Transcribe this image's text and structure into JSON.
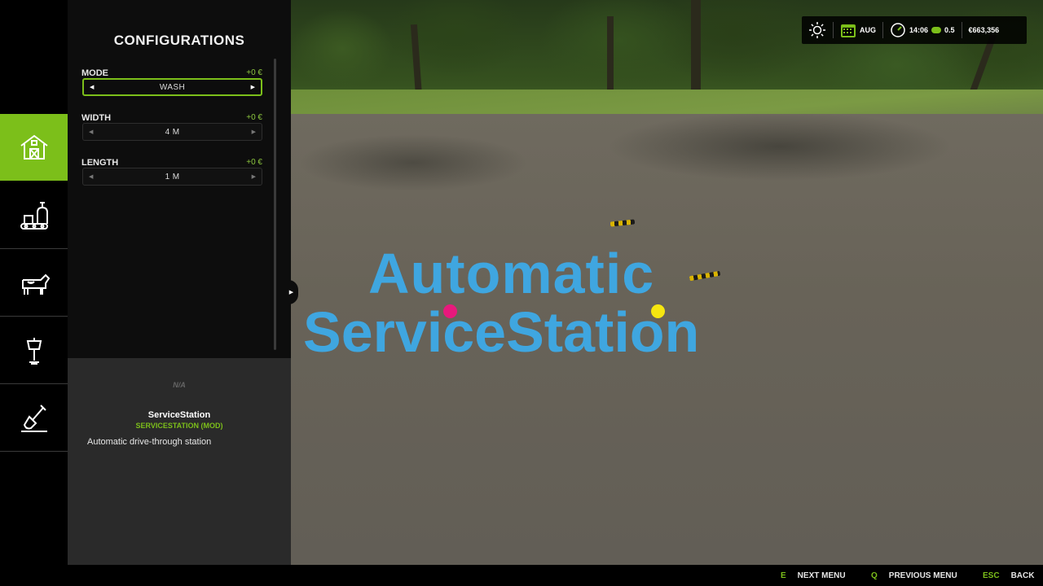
{
  "config_panel": {
    "title": "CONFIGURATIONS",
    "options": [
      {
        "label": "MODE",
        "price": "+0 €",
        "value": "WASH",
        "focused": true
      },
      {
        "label": "WIDTH",
        "price": "+0 €",
        "value": "4 M",
        "focused": false
      },
      {
        "label": "LENGTH",
        "price": "+0 €",
        "value": "1 M",
        "focused": false
      }
    ]
  },
  "info_panel": {
    "na_label": "N/A",
    "item_name": "ServiceStation",
    "mod_name": "SERVICESTATION (MOD)",
    "description": "Automatic drive-through station"
  },
  "categories": [
    {
      "icon": "barn-icon",
      "active": true
    },
    {
      "icon": "production-icon",
      "active": false
    },
    {
      "icon": "cow-icon",
      "active": false
    },
    {
      "icon": "lamp-icon",
      "active": false
    },
    {
      "icon": "shovel-icon",
      "active": false
    }
  ],
  "logo": {
    "line1": "Automatic",
    "line2": "ServiceStation",
    "color": "#3fa6e0",
    "dot_colors": [
      "#e8197c",
      "#f5e610"
    ]
  },
  "hud": {
    "weather_icon": "sun-icon",
    "month": "AUG",
    "time": "14:06",
    "speed": "0.5",
    "money": "€663,356"
  },
  "bottom_bar": {
    "next_menu": {
      "key": "E",
      "label": "NEXT MENU"
    },
    "previous_menu": {
      "key": "Q",
      "label": "PREVIOUS MENU"
    },
    "back": {
      "key": "ESC",
      "label": "BACK"
    }
  },
  "colors": {
    "accent": "#7cbf1a",
    "panel_dark": "#0d0d0d",
    "panel_info": "#2a2a2a"
  }
}
